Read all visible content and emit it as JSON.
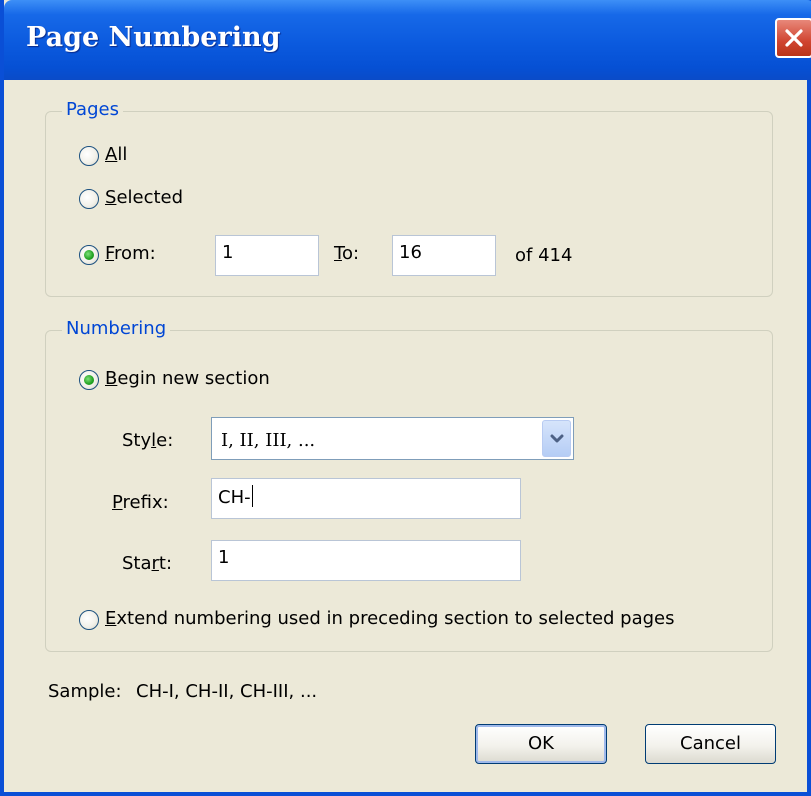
{
  "window": {
    "title": "Page Numbering"
  },
  "pages": {
    "legend": "Pages",
    "all": {
      "label_hot": "A",
      "label_rest": "ll",
      "checked": false
    },
    "selected": {
      "label_hot": "S",
      "label_rest": "elected",
      "checked": false
    },
    "from": {
      "label_hot": "F",
      "label_rest": "rom:",
      "checked": true,
      "value": "1"
    },
    "to": {
      "label_hot": "T",
      "label_rest": "o:",
      "value": "16"
    },
    "of_text": "of 414"
  },
  "numbering": {
    "legend": "Numbering",
    "begin_new_section": {
      "label_hot": "B",
      "label_rest": "egin new section",
      "checked": true
    },
    "style": {
      "label_pre": "Sty",
      "label_hot": "l",
      "label_post": "e:",
      "value": "I, II, III, ..."
    },
    "prefix": {
      "label_hot": "P",
      "label_rest": "refix:",
      "value": "CH-"
    },
    "start": {
      "label_pre": "Sta",
      "label_hot": "r",
      "label_post": "t:",
      "value": "1"
    },
    "extend": {
      "label_hot": "E",
      "label_rest": "xtend numbering used in preceding section to selected pages",
      "checked": false
    }
  },
  "sample": {
    "label": "Sample:",
    "value": "CH-I, CH-II, CH-III, ..."
  },
  "buttons": {
    "ok": "OK",
    "cancel": "Cancel"
  },
  "icons": {
    "close": "close-icon",
    "dropdown": "chevron-down-icon"
  },
  "colors": {
    "titlebar": "#0b5ade",
    "legend": "#0046d5",
    "dialog_bg": "#ece9d8",
    "close_button": "#d04430",
    "radio_dot": "#21a121"
  }
}
